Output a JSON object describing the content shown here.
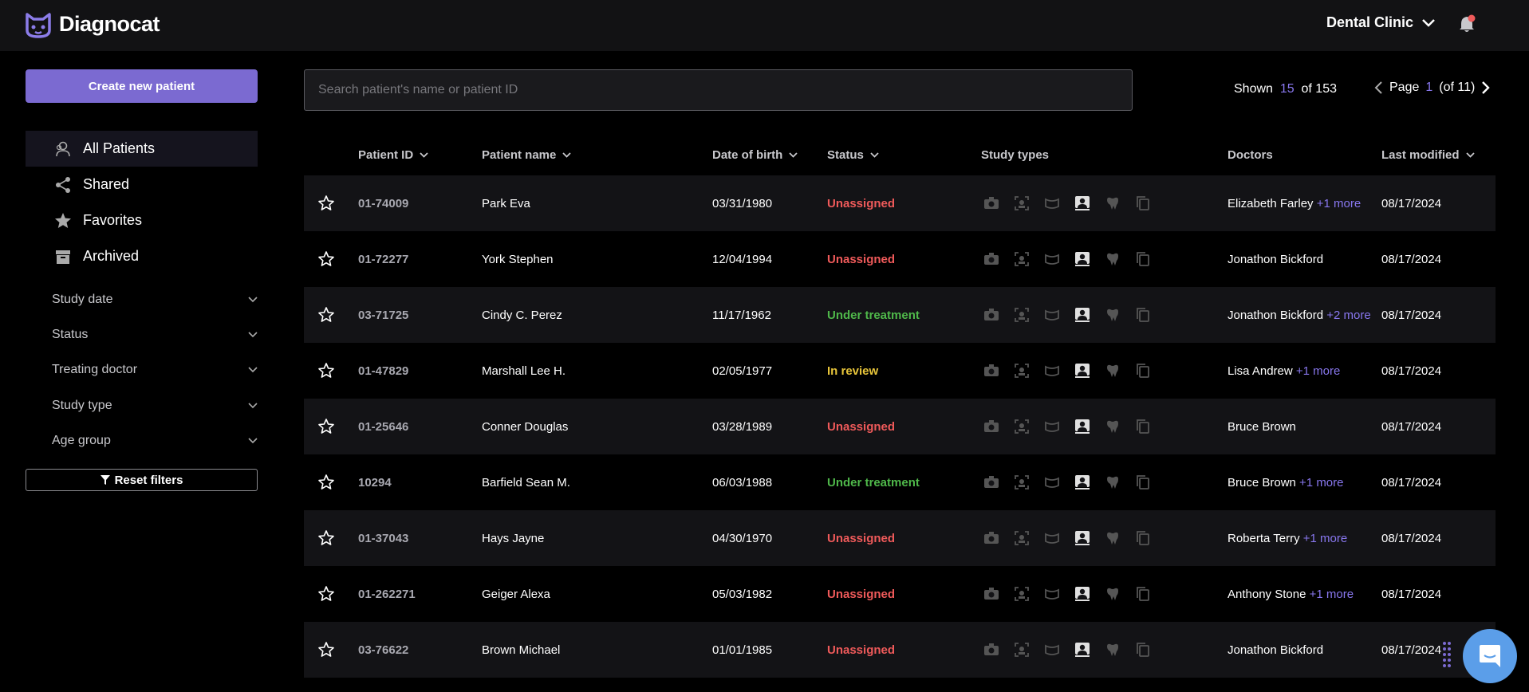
{
  "app": {
    "name": "Diagnocat",
    "clinic": "Dental Clinic"
  },
  "sidebar": {
    "create_label": "Create new patient",
    "nav": [
      {
        "label": "All Patients",
        "icon": "patients-icon"
      },
      {
        "label": "Shared",
        "icon": "share-icon"
      },
      {
        "label": "Favorites",
        "icon": "star-icon"
      },
      {
        "label": "Archived",
        "icon": "archive-icon"
      }
    ],
    "filters": [
      "Study date",
      "Status",
      "Treating doctor",
      "Study type",
      "Age group"
    ],
    "reset_label": "Reset filters"
  },
  "search": {
    "placeholder": "Search patient's name or patient ID"
  },
  "summary": {
    "shown_prefix": "Shown",
    "shown": "15",
    "of_label": "of 153",
    "page_label": "Page",
    "page": "1",
    "of_pages": "(of 11)"
  },
  "table": {
    "headers": [
      "Patient ID",
      "Patient name",
      "Date of birth",
      "Status",
      "Study types",
      "Doctors",
      "Last modified"
    ],
    "rows": [
      {
        "id": "01-74009",
        "name": "Park Eva",
        "dob": "03/31/1980",
        "status": "Unassigned",
        "doctor": "Elizabeth Farley",
        "more": "+1 more",
        "modified": "08/17/2024"
      },
      {
        "id": "01-72277",
        "name": "York Stephen",
        "dob": "12/04/1994",
        "status": "Unassigned",
        "doctor": "Jonathon Bickford",
        "more": "",
        "modified": "08/17/2024"
      },
      {
        "id": "03-71725",
        "name": "Cindy C. Perez",
        "dob": "11/17/1962",
        "status": "Under treatment",
        "doctor": "Jonathon Bickford",
        "more": "+2 more",
        "modified": "08/17/2024"
      },
      {
        "id": "01-47829",
        "name": "Marshall Lee H.",
        "dob": "02/05/1977",
        "status": "In review",
        "doctor": "Lisa Andrew",
        "more": "+1 more",
        "modified": "08/17/2024"
      },
      {
        "id": "01-25646",
        "name": "Conner Douglas",
        "dob": "03/28/1989",
        "status": "Unassigned",
        "doctor": "Bruce Brown",
        "more": "",
        "modified": "08/17/2024"
      },
      {
        "id": "10294",
        "name": "Barfield Sean M.",
        "dob": "06/03/1988",
        "status": "Under treatment",
        "doctor": "Bruce Brown",
        "more": "+1 more",
        "modified": "08/17/2024"
      },
      {
        "id": "01-37043",
        "name": "Hays Jayne",
        "dob": "04/30/1970",
        "status": "Unassigned",
        "doctor": "Roberta Terry",
        "more": "+1 more",
        "modified": "08/17/2024"
      },
      {
        "id": "01-262271",
        "name": "Geiger Alexa",
        "dob": "05/03/1982",
        "status": "Unassigned",
        "doctor": "Anthony Stone",
        "more": "+1 more",
        "modified": "08/17/2024"
      },
      {
        "id": "03-76622",
        "name": "Brown Michael",
        "dob": "01/01/1985",
        "status": "Unassigned",
        "doctor": "Jonathon Bickford",
        "more": "",
        "modified": "08/17/2024"
      }
    ]
  },
  "colors": {
    "accent": "#7b6ad1",
    "unassigned": "#ef5a5a",
    "under_treatment": "#4fb84a",
    "in_review": "#e8c53a"
  }
}
